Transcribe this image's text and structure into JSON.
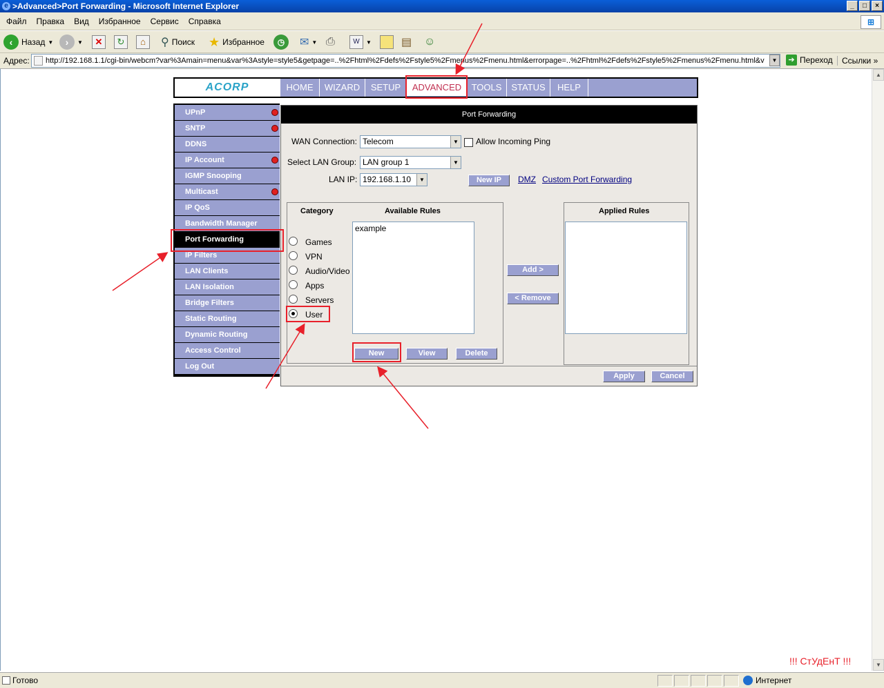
{
  "window": {
    "title": ">Advanced>Port Forwarding - Microsoft Internet Explorer"
  },
  "menu": {
    "items": [
      "Файл",
      "Правка",
      "Вид",
      "Избранное",
      "Сервис",
      "Справка"
    ]
  },
  "toolbar": {
    "back": "Назад",
    "search": "Поиск",
    "favorites": "Избранное"
  },
  "addressbar": {
    "label": "Адрес:",
    "url": "http://192.168.1.1/cgi-bin/webcm?var%3Amain=menu&var%3Astyle=style5&getpage=..%2Fhtml%2Fdefs%2Fstyle5%2Fmenus%2Fmenu.html&errorpage=..%2Fhtml%2Fdefs%2Fstyle5%2Fmenus%2Fmenu.html&v",
    "go": "Переход",
    "links": "Ссылки"
  },
  "router": {
    "logo": "ACORP",
    "nav": [
      "HOME",
      "WIZARD",
      "SETUP",
      "ADVANCED",
      "TOOLS",
      "STATUS",
      "HELP"
    ],
    "active_nav": "ADVANCED",
    "sidebar": [
      {
        "label": "UPnP",
        "dot": true
      },
      {
        "label": "SNTP",
        "dot": true
      },
      {
        "label": "DDNS",
        "dot": false
      },
      {
        "label": "IP Account",
        "dot": true
      },
      {
        "label": "IGMP Snooping",
        "dot": false
      },
      {
        "label": "Multicast",
        "dot": true
      },
      {
        "label": "IP QoS",
        "dot": false
      },
      {
        "label": "Bandwidth Manager",
        "dot": false
      },
      {
        "label": "Port Forwarding",
        "dot": false
      },
      {
        "label": "IP Filters",
        "dot": false
      },
      {
        "label": "LAN Clients",
        "dot": false
      },
      {
        "label": "LAN Isolation",
        "dot": false
      },
      {
        "label": "Bridge Filters",
        "dot": false
      },
      {
        "label": "Static Routing",
        "dot": false
      },
      {
        "label": "Dynamic Routing",
        "dot": false
      },
      {
        "label": "Access Control",
        "dot": false
      },
      {
        "label": "Log Out",
        "dot": false
      }
    ],
    "panel": {
      "title": "Port Forwarding",
      "wan_label": "WAN Connection:",
      "wan_value": "Telecom",
      "allow_ping": "Allow Incoming Ping",
      "lan_group_label": "Select LAN Group:",
      "lan_group_value": "LAN group 1",
      "lan_ip_label": "LAN IP:",
      "lan_ip_value": "192.168.1.10",
      "new_ip": "New IP",
      "dmz": "DMZ",
      "custom": "Custom Port Forwarding",
      "category_header": "Category",
      "available_header": "Available Rules",
      "applied_header": "Applied Rules",
      "categories": [
        "Games",
        "VPN",
        "Audio/Video",
        "Apps",
        "Servers",
        "User"
      ],
      "selected_category": "User",
      "available_rules": [
        "example"
      ],
      "add": "Add >",
      "remove": "< Remove",
      "new": "New",
      "view": "View",
      "delete": "Delete",
      "apply": "Apply",
      "cancel": "Cancel"
    }
  },
  "status": {
    "text": "Готово",
    "zone": "Интернет"
  },
  "watermark": "!!! СтУдЕнТ !!!"
}
